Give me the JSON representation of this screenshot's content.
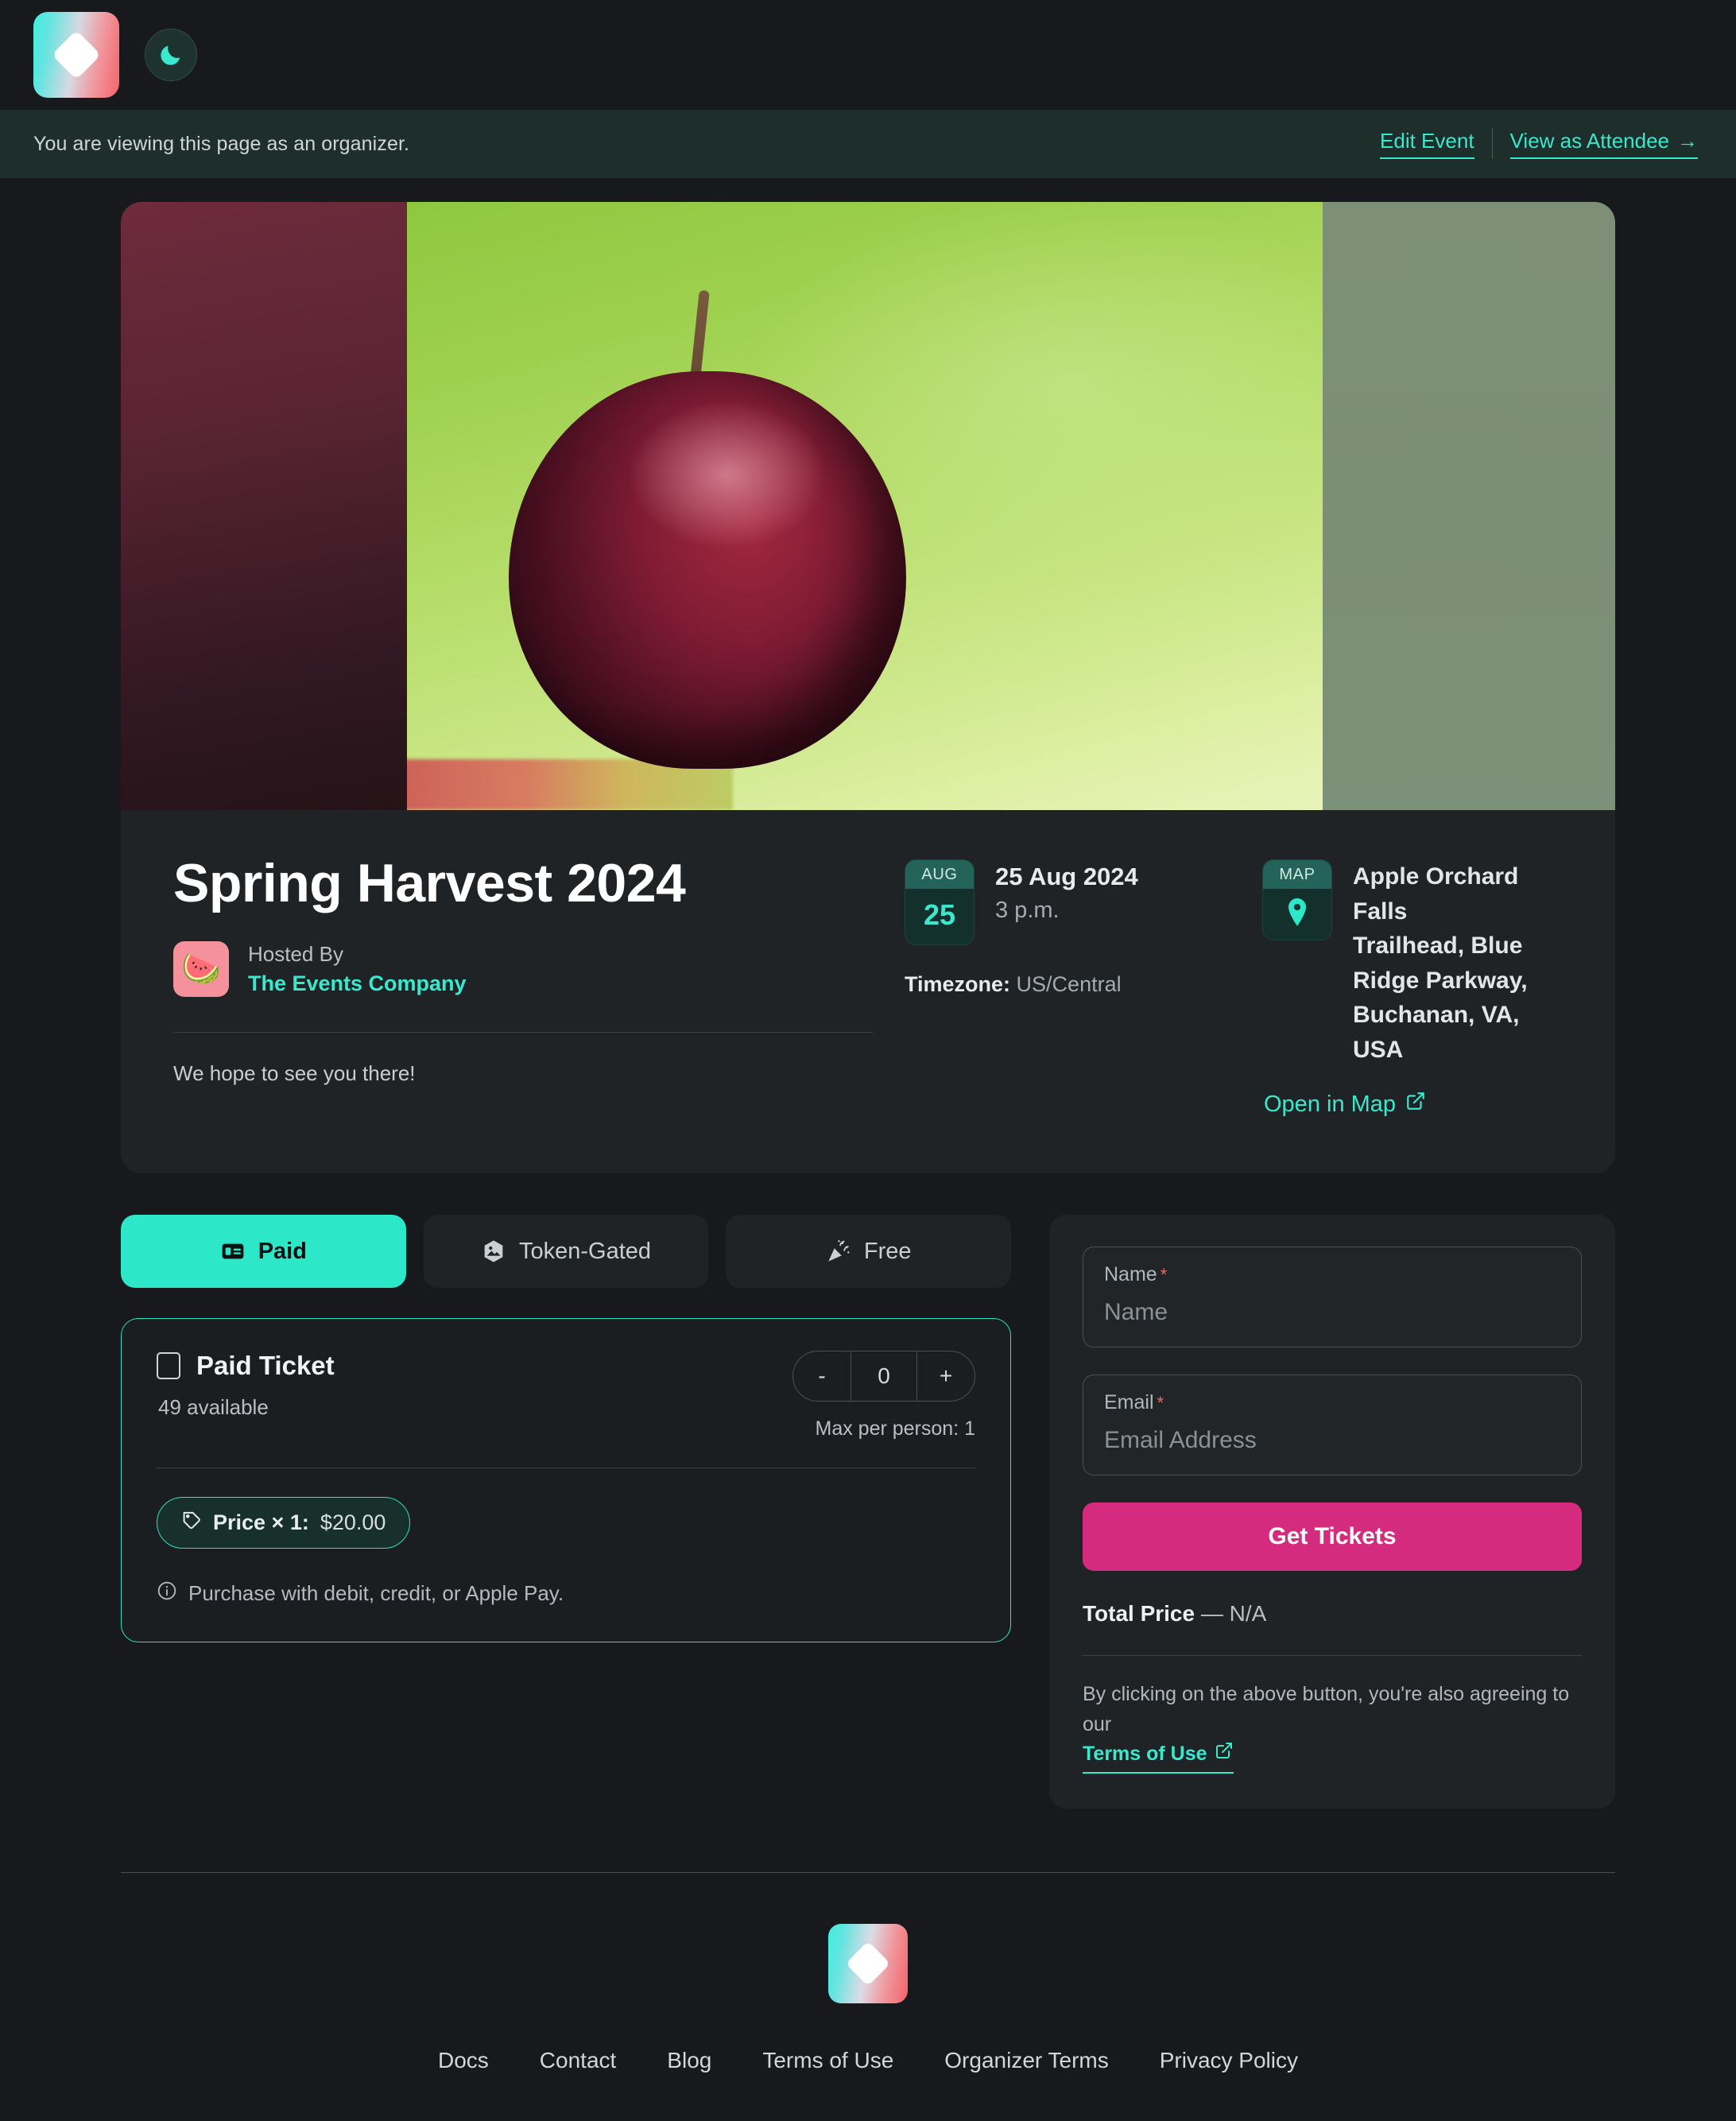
{
  "brand": {
    "logo_icon": "diamond-logo-icon",
    "theme_toggle_icon": "moon-icon"
  },
  "organizer_banner": {
    "message": "You are viewing this page as an organizer.",
    "edit_label": "Edit Event",
    "view_label": "View as Attendee",
    "view_arrow": "→"
  },
  "event": {
    "title": "Spring Harvest 2024",
    "hosted_by_label": "Hosted By",
    "host_name": "The Events Company",
    "host_avatar_icon": "watermelon-icon",
    "description": "We hope to see you there!",
    "date_chip_month": "AUG",
    "date_chip_day": "25",
    "date_text": "25 Aug 2024",
    "time_text": "3 p.m.",
    "timezone_label": "Timezone:",
    "timezone_value": "US/Central",
    "map_chip_label": "MAP",
    "map_chip_icon": "map-pin-icon",
    "address_lines": [
      "Apple Orchard Falls",
      "Trailhead, Blue",
      "Ridge Parkway,",
      "Buchanan, VA, USA"
    ],
    "open_in_map_label": "Open in Map",
    "open_in_map_icon": "external-link-icon"
  },
  "ticket_tabs": [
    {
      "label": "Paid",
      "icon": "money-card-icon",
      "active": true
    },
    {
      "label": "Token-Gated",
      "icon": "hexagon-nft-icon",
      "active": false
    },
    {
      "label": "Free",
      "icon": "confetti-icon",
      "active": false
    }
  ],
  "ticket": {
    "name": "Paid Ticket",
    "availability": "49 available",
    "max_per_person": "Max per person: 1",
    "quantity": "0",
    "decrement_label": "-",
    "increment_label": "+",
    "price_label": "Price × 1:",
    "price_value": "$20.00",
    "price_icon": "tag-icon",
    "note": "Purchase with debit, credit, or Apple Pay.",
    "note_icon": "info-icon",
    "checkbox_icon": "checkbox-unchecked-icon"
  },
  "checkout": {
    "name_label": "Name",
    "name_required": "*",
    "name_placeholder": "Name",
    "name_value": "",
    "email_label": "Email",
    "email_required": "*",
    "email_placeholder": "Email Address",
    "email_value": "",
    "submit_label": "Get Tickets",
    "total_label": "Total Price",
    "total_value": "— N/A",
    "terms_prefix": "By clicking on the above button, you're also agreeing to our",
    "terms_link_label": "Terms of Use",
    "terms_link_icon": "external-link-icon"
  },
  "footer": {
    "logo_icon": "diamond-logo-icon",
    "links": [
      "Docs",
      "Contact",
      "Blog",
      "Terms of Use",
      "Organizer Terms",
      "Privacy Policy"
    ]
  },
  "colors": {
    "page_bg": "#17191c",
    "panel_bg": "#202326",
    "accent_teal": "#3ae8cd",
    "accent_teal_solid": "#2ce8c8",
    "accent_pink": "#d42b7f",
    "banner_bg": "#1d2e2b",
    "required_red": "#ef6a5f"
  }
}
